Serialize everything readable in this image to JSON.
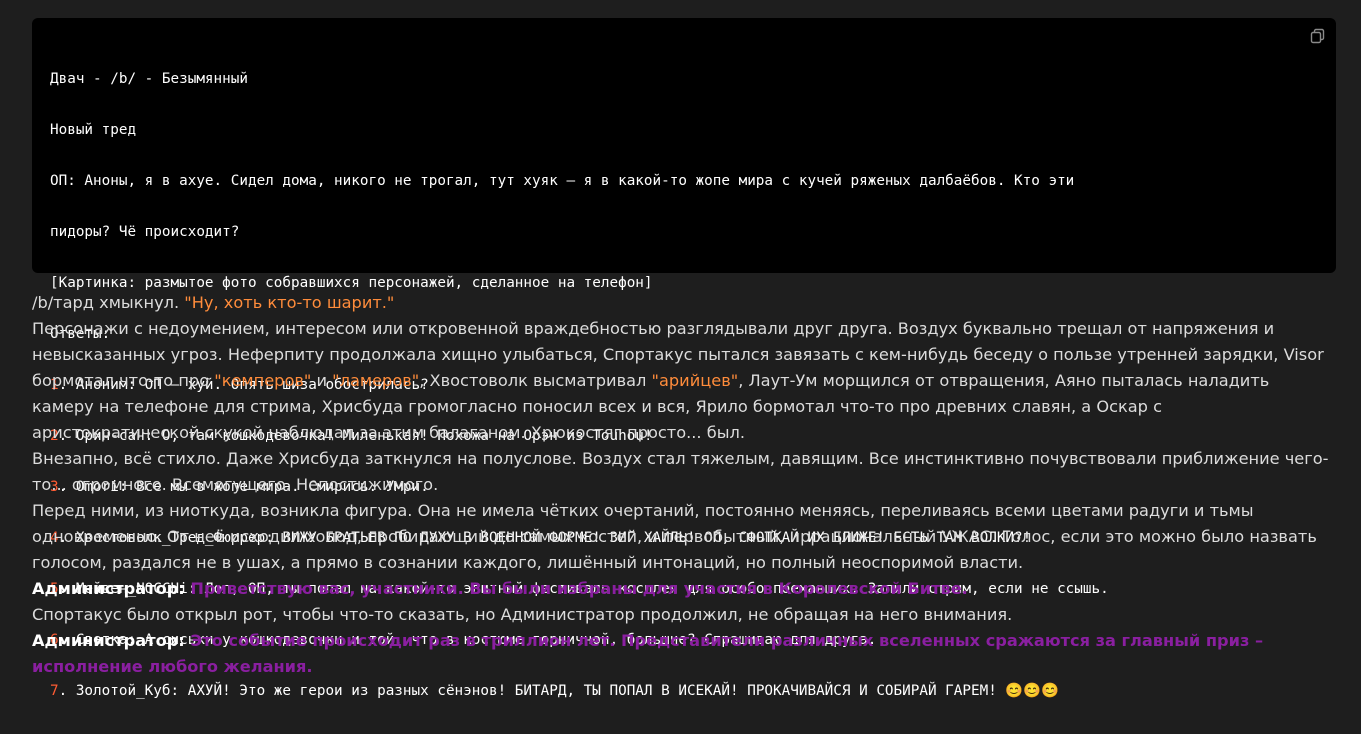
{
  "code_block": {
    "lines": [
      "Двач - /b/ - Безымянный",
      "Новый тред",
      "ОП: Аноны, я в ахуе. Сидел дома, никого не трогал, тут хуяк – я в какой-то жопе мира с кучей ряженых далбаёбов. Кто эти",
      "пидоры? Чё происходит?",
      "[Картинка: размытое фото собравшихся персонажей, сделанное на телефон]",
      "Ответы:"
    ],
    "replies": [
      {
        "n": "1",
        "text": ". Аноним: ОП – хуй. Опять шиза обострилась?"
      },
      {
        "n": "2",
        "text": ". Орин-сан: О, там кошкодевочка! Миленькая! Похожа на Орэн из Touhou!"
      },
      {
        "n": "3",
        "text": ". Omori: Все мы в жопе мира. Смирись. Умри."
      },
      {
        "n": "4",
        "text": ". Хвостоволк_Тред_Фюррер: ВИЖУ БРАТЬЕВ ПО ДУХУ В ВОЕННОЙ ФОРМЕ! ЗИГ ХАЙЛЬ! ОП, СФОТКАЙ ИХ БЛИЖЕ! ЕСТЬ ТАМ ВОЛКИ?!"
      },
      {
        "n": "5",
        "text": ". Мейвен_NOCCHi: Лол, ОП, ты попал на какой-то элитный фестиваль косплея для особо поехавших. Запили стрим, если не ссышь."
      },
      {
        "n": "6",
        "text": ". Светка: А сиськи у кошкодевочки и той, что в костюме горничной, большие? Спрашиваю для друга."
      },
      {
        "n": "7",
        "text": ". Золотой_Куб: АХУЙ! Это же герои из разных сёнэнов! БИТАРД, ТЫ ПОПАЛ В ИСЕКАЙ! ПРОКАЧИВАЙСЯ И СОБИРАЙ ГАРЕМ! 😊😊😊"
      }
    ],
    "copy_icon": "copy-icon"
  },
  "prose": {
    "p1_a": "/b/тард хмыкнул. ",
    "p1_quote": "\"Ну, хоть кто-то шарит.\"",
    "p2_a": "Персонажи с недоумением, интересом или откровенной враждебностью разглядывали друг друга. Воздух буквально трещал от напряжения и невысказанных угроз. Неферпиту продолжала хищно улыбаться, Спортакус пытался завязать с кем-нибудь беседу о пользе утренней зарядки, Visor бормотал что-то про ",
    "p2_q1": "\"кемперов\"",
    "p2_b": " и ",
    "p2_q2": "\"ламеров\"",
    "p2_c": ", Хвостоволк высматривал ",
    "p2_q3": "\"арийцев\"",
    "p2_d": ", Лаут-Ум морщился от отвращения, Аяно пыталась наладить камеру на телефоне для стрима, Хрисбуда громогласно поносил всех и вся, Ярило бормотал что-то про древних славян, а Оскар с аристократической скукой наблюдал за этим балаганом. Хрюкостяг просто... был.",
    "p3": "Внезапно, всё стихло. Даже Хрисбуда заткнулся на полуслове. Воздух стал тяжелым, давящим. Все инстинктивно почувствовали приближение чего-то... огромного. Всемогущего. Непостижимого.",
    "p4": "Перед ними, из ниоткуда, возникла фигура. Она не имела чётких очертаний, постоянно меняясь, переливаясь всеми цветами радуги и тьмы одновременно. От неё исходил холод, пробирающий до самых костей, и первобытный, иррациональный УЖАС. Голос, если это можно было назвать голосом, раздался не в ушах, а прямо в сознании каждого, лишённый интонаций, но полный неоспоримой власти.",
    "p5_label": "Администратор:",
    "p5_speech": " Приветствую вас, участники. Вы были избраны для участия в Королевской Битве.",
    "p6": "Спортакус было открыл рот, чтобы что-то сказать, но Администратор продолжил, не обращая на него внимания.",
    "p7_label": "Администратор:",
    "p7_speech": " Это событие происходит раз в триллион лет. Представители различных вселенных сражаются за главный приз – исполнение любого желания."
  }
}
